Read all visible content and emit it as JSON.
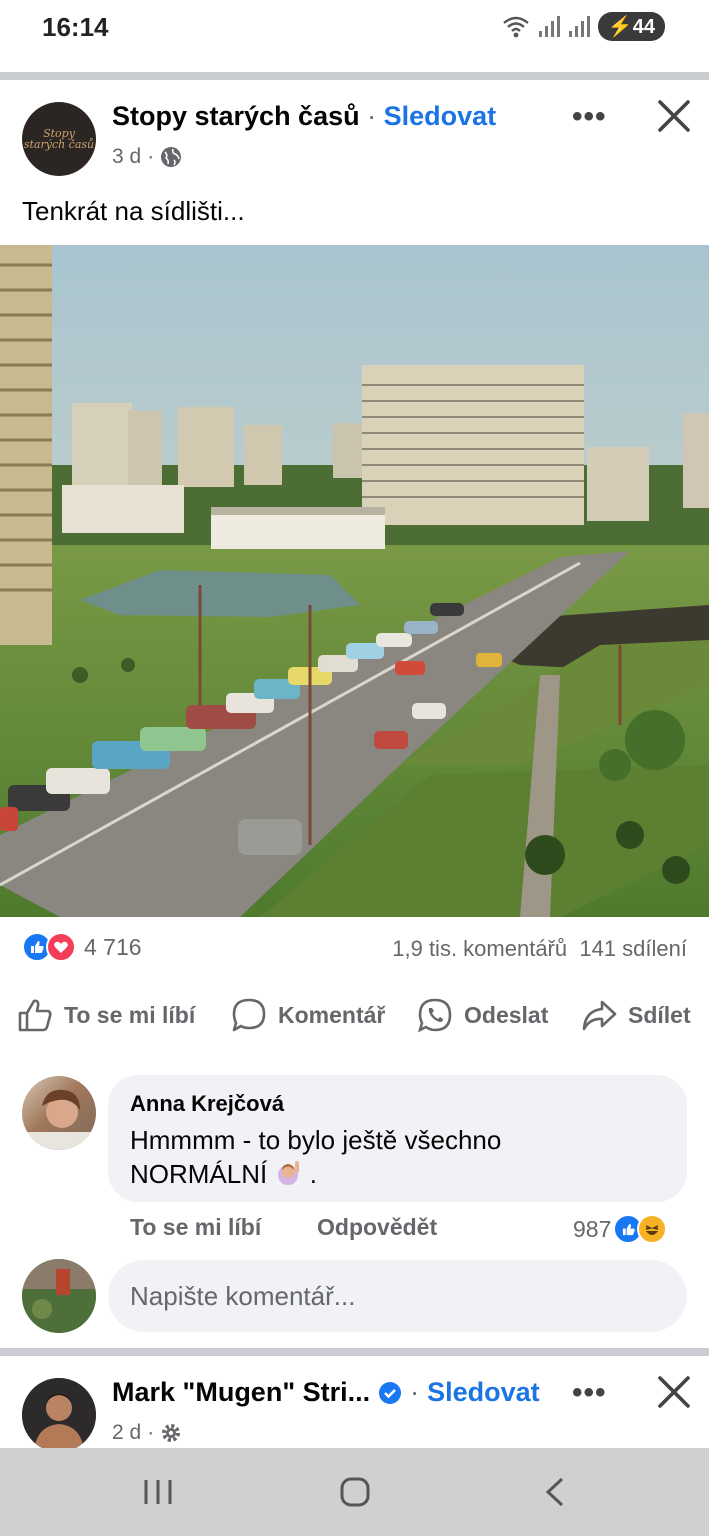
{
  "status_bar": {
    "time": "16:14",
    "battery": "44"
  },
  "post": {
    "page_name": "Stopy starých časů",
    "separator": "·",
    "follow_label": "Sledovat",
    "time_ago": "3 d",
    "meta_dot": "·",
    "avatar_text": "Stopy starých časů",
    "text": "Tenkrát na sídlišti...",
    "reaction_count": "4 716",
    "comments_count": "1,9 tis. komentářů",
    "shares_count": "141 sdílení"
  },
  "actions": {
    "like": "To se mi líbí",
    "comment": "Komentář",
    "send": "Odeslat",
    "share": "Sdílet"
  },
  "comment": {
    "author": "Anna Krejčová",
    "text_line1": "Hmmmm - to bylo ještě všechno",
    "text_line2": "NORMÁLNÍ",
    "text_end": ".",
    "like_label": "To se mi líbí",
    "reply_label": "Odpovědět",
    "reaction_count": "987"
  },
  "composer": {
    "placeholder": "Napište komentář..."
  },
  "next_post": {
    "page_name": "Mark \"Mugen\" Stri...",
    "follow_label": "Sledovat",
    "separator": "·",
    "time_ago": "2 d",
    "meta_dot": "·"
  },
  "colors": {
    "accent": "#1b74e4",
    "like_blue": "#1877f2",
    "love_red": "#f33e58",
    "muted": "#65676b"
  }
}
